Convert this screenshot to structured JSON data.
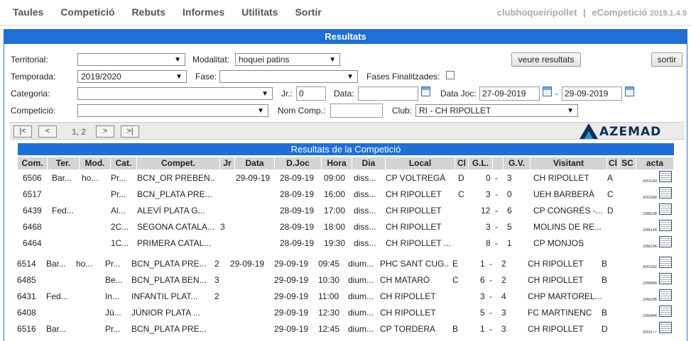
{
  "menu": [
    "Taules",
    "Competició",
    "Rebuts",
    "Informes",
    "Utilitats",
    "Sortir"
  ],
  "brand": {
    "club": "clubhoqueiripollet",
    "sep": "|",
    "app": "eCompetició",
    "version": "2019.1.4.9"
  },
  "panel_title": "Resultats",
  "filters": {
    "territorial_label": "Territorial:",
    "territorial_value": "",
    "modalitat_label": "Modalitat:",
    "modalitat_value": "hoquei patins",
    "temporada_label": "Temporada:",
    "temporada_value": "2019/2020",
    "fase_label": "Fase:",
    "fase_value": "",
    "fases_fin_label": "Fases Finalitzades:",
    "categoria_label": "Categoria:",
    "categoria_value": "",
    "jr_label": "Jr.:",
    "jr_value": "0",
    "data_label": "Data:",
    "data_value": "",
    "datajoc_label": "Data Joc:",
    "datajoc_from": "27-09-2019",
    "datajoc_dash": "-",
    "datajoc_to": "29-09-2019",
    "competicio_label": "Competició:",
    "competicio_value": "",
    "nomcomp_label": "Nom Comp.:",
    "nomcomp_value": "",
    "club_label": "Club:",
    "club_value": "RI - CH RIPOLLET"
  },
  "buttons": {
    "veure": "veure resultats",
    "sortir": "sortir"
  },
  "pager": {
    "first": "|<",
    "prev": "<",
    "pages": "1, 2",
    "next": ">",
    "last": ">|"
  },
  "logo_text": "AZEMAD",
  "results_title": "Resultats de la Competició",
  "columns": [
    "Com.",
    "Ter.",
    "Mod.",
    "Cat.",
    "Compet.",
    "Jr",
    "Data",
    "D.Joc",
    "Hora",
    "Dia",
    "Local",
    "Cl",
    "G.L.",
    "",
    "G.V.",
    "Visitant",
    "Cl",
    "SC",
    "acta"
  ],
  "rows": [
    {
      "com": "6506",
      "ter": "Bar...",
      "mod": "ho...",
      "cat": "Pr...",
      "compet": "BCN_OR PREBEN...",
      "jr": "",
      "data": "29-09-19",
      "djoc": "28-09-19",
      "hora": "09:00",
      "dia": "diss...",
      "local": "CP VOLTREGÀ",
      "cl": "D",
      "gl": "0",
      "dash": "-",
      "gv": "3",
      "visitant": "CH RIPOLLET",
      "clv": "A",
      "sc": "",
      "acta": "300189"
    },
    {
      "com": "6517",
      "ter": "",
      "mod": "",
      "cat": "Pr...",
      "compet": "BCN_PLATA PRE...",
      "jr": "",
      "data": "",
      "djoc": "28-09-19",
      "hora": "16:00",
      "dia": "diss...",
      "local": "CH RIPOLLET",
      "cl": "C",
      "gl": "3",
      "dash": "-",
      "gv": "0",
      "visitant": "UEH BARBERÀ",
      "clv": "C",
      "sc": "",
      "acta": "300288"
    },
    {
      "com": "6439",
      "ter": "Fed...",
      "mod": "",
      "cat": "Al...",
      "compet": "ALEVÍ PLATA G...",
      "jr": "",
      "data": "",
      "djoc": "28-09-19",
      "hora": "17:00",
      "dia": "diss...",
      "local": "CH RIPOLLET",
      "cl": "",
      "gl": "12",
      "dash": "-",
      "gv": "6",
      "visitant": "CP CONGRÉS -...",
      "clv": "D",
      "sc": "",
      "acta": "296526"
    },
    {
      "com": "6468",
      "ter": "",
      "mod": "",
      "cat": "2C...",
      "compet": "SEGONA CATALA...",
      "jr": "3",
      "data": "",
      "djoc": "28-09-19",
      "hora": "18:00",
      "dia": "diss...",
      "local": "CH RIPOLLET",
      "cl": "",
      "gl": "3",
      "dash": "-",
      "gv": "5",
      "visitant": "MOLINS DE RE...",
      "clv": "",
      "sc": "",
      "acta": "298334"
    },
    {
      "com": "6464",
      "ter": "",
      "mod": "",
      "cat": "1C...",
      "compet": "PRIMERA CATAL...",
      "jr": "",
      "data": "",
      "djoc": "28-09-19",
      "hora": "19:30",
      "dia": "diss...",
      "local": "CH RIPOLLET ...",
      "cl": "",
      "gl": "8",
      "dash": "-",
      "gv": "1",
      "visitant": "CP MONJOS",
      "clv": "",
      "sc": "",
      "acta": "298234"
    },
    {
      "com": "6514",
      "ter": "Bar...",
      "mod": "ho...",
      "cat": "Pr...",
      "compet": "BCN_PLATA PRE...",
      "jr": "2",
      "data": "29-09-19",
      "djoc": "29-09-19",
      "hora": "09:45",
      "dia": "dium...",
      "local": "PHC SANT CUG...",
      "cl": "E",
      "gl": "1",
      "dash": "-",
      "gv": "2",
      "visitant": "CH RIPOLLET",
      "clv": "B",
      "sc": "",
      "acta": "300282"
    },
    {
      "com": "6485",
      "ter": "",
      "mod": "",
      "cat": "Be...",
      "compet": "BCN_PLATA BEN...",
      "jr": "3",
      "data": "",
      "djoc": "29-09-19",
      "hora": "10:30",
      "dia": "dium...",
      "local": "CH MATARÓ",
      "cl": "C",
      "gl": "6",
      "dash": "-",
      "gv": "2",
      "visitant": "CH RIPOLLET",
      "clv": "B",
      "sc": "",
      "acta": "299885"
    },
    {
      "com": "6431",
      "ter": "Fed...",
      "mod": "",
      "cat": "In...",
      "compet": "INFANTIL PLAT...",
      "jr": "2",
      "data": "",
      "djoc": "29-09-19",
      "hora": "11:00",
      "dia": "dium...",
      "local": "CH RIPOLLET",
      "cl": "",
      "gl": "3",
      "dash": "-",
      "gv": "4",
      "visitant": "CHP MARTOREL...",
      "clv": "",
      "sc": "",
      "acta": "296296"
    },
    {
      "com": "6408",
      "ter": "",
      "mod": "",
      "cat": "Jú...",
      "compet": "JÚNIOR PLATA ...",
      "jr": "",
      "data": "",
      "djoc": "29-09-19",
      "hora": "12:30",
      "dia": "dium...",
      "local": "CH RIPOLLET",
      "cl": "",
      "gl": "5",
      "dash": "-",
      "gv": "3",
      "visitant": "FC MARTINENC",
      "clv": "B",
      "sc": "",
      "acta": "295964"
    },
    {
      "com": "6516",
      "ter": "Bar...",
      "mod": "",
      "cat": "Pr...",
      "compet": "BCN_PLATA PRE...",
      "jr": "",
      "data": "",
      "djoc": "29-09-19",
      "hora": "12:45",
      "dia": "dium...",
      "local": "CP TORDERA",
      "cl": "B",
      "gl": "1",
      "dash": "-",
      "gv": "3",
      "visitant": "CH RIPOLLET",
      "clv": "D",
      "sc": "",
      "acta": "300277"
    }
  ]
}
